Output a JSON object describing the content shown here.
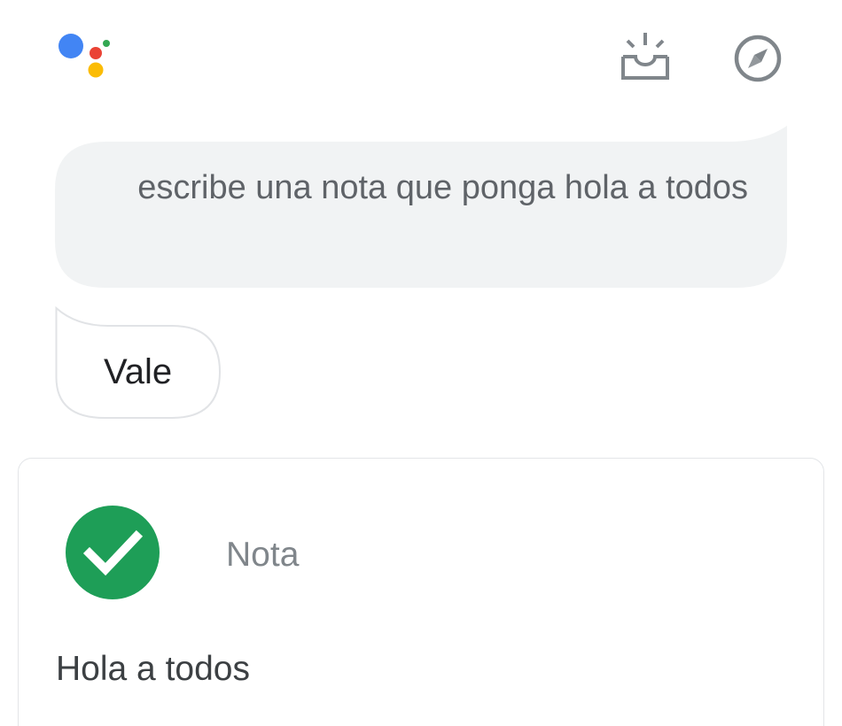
{
  "conversation": {
    "user_query": "escribe una nota que ponga hola a todos",
    "assistant_reply": "Vale"
  },
  "note_card": {
    "title": "Nota",
    "content": "Hola a todos"
  },
  "icons": {
    "logo": "google-assistant-logo",
    "updates": "updates-tray-icon",
    "explore": "compass-icon",
    "confirmation": "check-circle-icon"
  },
  "colors": {
    "logo_blue": "#4285f4",
    "logo_red": "#ea4335",
    "logo_yellow": "#fbbc05",
    "logo_green": "#34a853",
    "check_green": "#1e9e57",
    "user_bubble_bg": "#f1f3f4",
    "reply_bubble_border": "#e1e3e6"
  }
}
